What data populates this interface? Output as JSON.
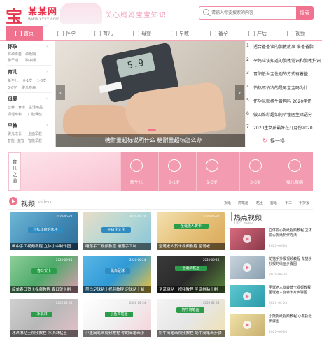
{
  "header": {
    "logo_mark": "宝",
    "logo_name": "某某网",
    "logo_url": "www.xxxx.com",
    "slogan": "关心妈妈宝宝知识",
    "search_placeholder": "请输入你要搜索的内容",
    "search_button": "搜索"
  },
  "nav": [
    {
      "label": "首页",
      "icon": "home-icon"
    },
    {
      "label": "怀孕",
      "icon": "pregnancy-icon"
    },
    {
      "label": "育儿",
      "icon": "parenting-icon"
    },
    {
      "label": "母婴",
      "icon": "mother-baby-icon"
    },
    {
      "label": "早教",
      "icon": "early-education-icon"
    },
    {
      "label": "备孕",
      "icon": "prepare-pregnancy-icon"
    },
    {
      "label": "产后",
      "icon": "postpartum-icon"
    },
    {
      "label": "视频",
      "icon": "video-icon"
    }
  ],
  "sidebar": [
    {
      "title": "怀孕",
      "links": [
        "怀孕准备",
        "孕晚期",
        "孕早期",
        "孕中期"
      ]
    },
    {
      "title": "育儿",
      "links": [
        "新生儿",
        "0-1岁",
        "1-3岁",
        "3-6岁",
        "婴儿疾病"
      ]
    },
    {
      "title": "母婴",
      "links": [
        "营养",
        "食谱",
        "生活用品",
        "调理布料",
        "口腔保健"
      ]
    },
    {
      "title": "早教",
      "links": [
        "婴儿成长",
        "全面早教",
        "智能",
        "益智",
        "智能早教"
      ]
    }
  ],
  "banner": {
    "caption": "糖耐量超标说明什么 糖耐量超标怎么办",
    "meter_reading": "5.9",
    "prev": "‹",
    "next": "›"
  },
  "news": [
    {
      "num": "1",
      "text": "适合爸爸读的胎教故事 准爸爸胎"
    },
    {
      "num": "2",
      "text": "孕妈应该知道的胎教常识和胎教护识"
    },
    {
      "num": "3",
      "text": "胃阳低血宝性别的方式有着些"
    },
    {
      "num": "4",
      "text": "怕热不怕冷的是男宝宝吗为什"
    },
    {
      "num": "5",
      "text": "怀孕米糖檀生黄鸭吗 2020年怀"
    },
    {
      "num": "6",
      "text": "做四维彩超如何听懂医生暗语分"
    },
    {
      "num": "7",
      "text": "2020生女孩最好在几月份2020"
    }
  ],
  "news_switch": "换一换",
  "stages": {
    "title": "育儿之道",
    "items": [
      "新生儿",
      "0-1岁",
      "1-3岁",
      "3-6岁",
      "婴儿疾病"
    ]
  },
  "video": {
    "title": "视频",
    "subtitle": "video",
    "tags": [
      "折纸",
      "简笔画",
      "粘土",
      "剪纸",
      "手工",
      "手抄报"
    ],
    "items": [
      {
        "date": "2020-06-24",
        "caption": "画中手工视频教程 立体小中制作图",
        "banner": "粒红样荷的水杯"
      },
      {
        "date": "2020-06-24",
        "caption": "睡莲手工视频教程 睡莲手工制",
        "banner": "平白花文花"
      },
      {
        "date": "2020-06-24",
        "caption": "圣诞老人贺卡视频教程 圣诞老",
        "banner": "圣诞老人贺卡"
      },
      {
        "date": "2020-06-24",
        "caption": "简单春日贺卡视频教程 春日贺卡制",
        "banner": "春日贺卡"
      },
      {
        "date": "2020-06-24",
        "caption": "黑白足球粘土视频教程 足球粘土制",
        "banner": "黑白足球"
      },
      {
        "date": "2020-06-24",
        "caption": "圣诞树粘土视频教程 圣诞树粘土制",
        "banner": "圣诞树粘土"
      },
      {
        "date": "2020-06-24",
        "caption": "冰淇淋粘土视频教程 冰淇淋粘土",
        "banner": "冰淇淋"
      },
      {
        "date": "2020-06-24",
        "caption": "小鱼简笔画视频教程 你的简笔画小",
        "banner": "小鱼简笔画"
      },
      {
        "date": "2020-06-24",
        "caption": "奶牛简笔画视频教程 奶牛简笔画步骤",
        "banner": "奶牛简笔画"
      }
    ]
  },
  "hot": {
    "title": "热点视频",
    "subtitle": "HOT video",
    "items": [
      {
        "title": "立体爱心折纸视频教程 立体爱心折纸制作方法",
        "date": "2020-06-24"
      },
      {
        "title": "龙猫手抄报视频教程 龙猫手抄报的绘画步骤图",
        "date": "2020-06-24"
      },
      {
        "title": "圣诞老人旋转贺卡视频教程 圣诞老人旋转卡片步骤图",
        "date": "2020-06-24"
      },
      {
        "title": "小熊折纸视频教程 小熊折纸步骤图",
        "date": "2020-06-24"
      }
    ]
  },
  "colors": {
    "accent": "#f0728e",
    "accent_light": "#f39bb0",
    "logo": "#e8384f"
  }
}
